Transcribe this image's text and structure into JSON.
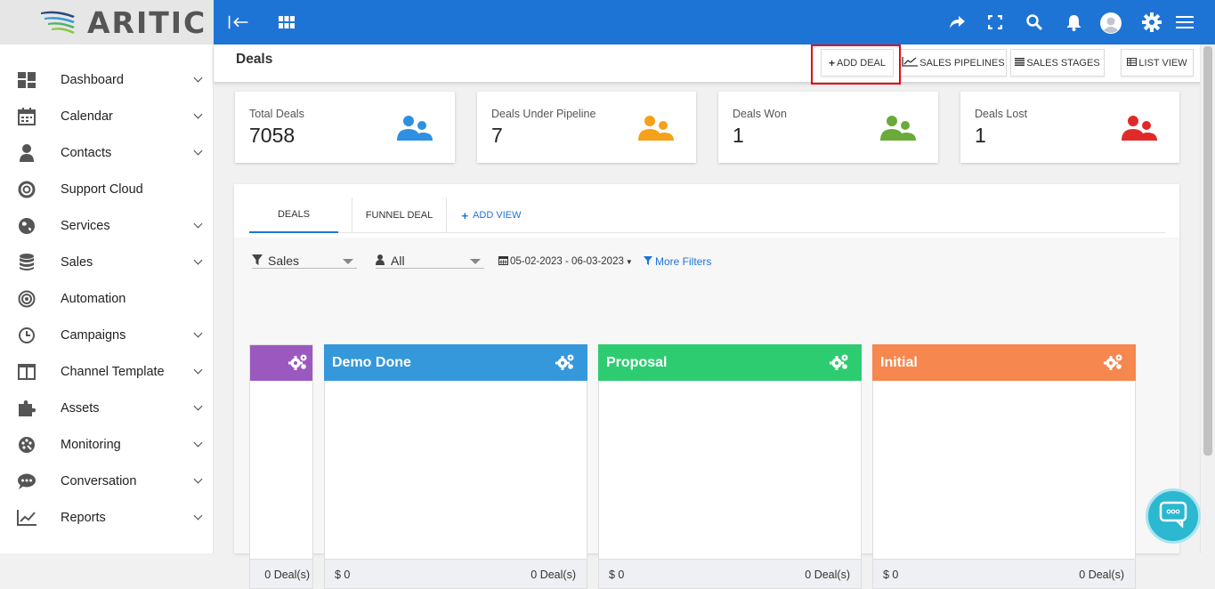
{
  "app": {
    "logo_text": "ARITIC"
  },
  "sidebar": {
    "items": [
      {
        "label": "Dashboard",
        "icon": "dashboard-icon",
        "expandable": true
      },
      {
        "label": "Calendar",
        "icon": "calendar-icon",
        "expandable": true
      },
      {
        "label": "Contacts",
        "icon": "user-icon",
        "expandable": true
      },
      {
        "label": "Support Cloud",
        "icon": "lifebuoy-icon",
        "expandable": false
      },
      {
        "label": "Services",
        "icon": "globe-icon",
        "expandable": true
      },
      {
        "label": "Sales",
        "icon": "database-icon",
        "expandable": true
      },
      {
        "label": "Automation",
        "icon": "target-icon",
        "expandable": false
      },
      {
        "label": "Campaigns",
        "icon": "clock-icon",
        "expandable": true
      },
      {
        "label": "Channel Template",
        "icon": "columns-icon",
        "expandable": true
      },
      {
        "label": "Assets",
        "icon": "puzzle-icon",
        "expandable": true
      },
      {
        "label": "Monitoring",
        "icon": "palette-icon",
        "expandable": true
      },
      {
        "label": "Conversation",
        "icon": "chat-icon",
        "expandable": true
      },
      {
        "label": "Reports",
        "icon": "line-chart-icon",
        "expandable": true
      }
    ]
  },
  "header": {
    "page_title": "Deals",
    "buttons": {
      "add_deal": "ADD DEAL",
      "sales_pipelines": "SALES PIPELINES",
      "sales_stages": "SALES STAGES",
      "list_view": "LIST VIEW"
    }
  },
  "stats": [
    {
      "label": "Total Deals",
      "value": "7058",
      "color": "#2f8fe0"
    },
    {
      "label": "Deals Under Pipeline",
      "value": "7",
      "color": "#f5a11a"
    },
    {
      "label": "Deals Won",
      "value": "1",
      "color": "#6aaa3a"
    },
    {
      "label": "Deals Lost",
      "value": "1",
      "color": "#e02a2a"
    }
  ],
  "tabs": {
    "deals": "DEALS",
    "funnel_deal": "FUNNEL DEAL",
    "add_view": "ADD VIEW"
  },
  "filters": {
    "pipeline": "Sales",
    "owner": "All",
    "date_range": "05-02-2023 - 06-03-2023",
    "more_filters": "More Filters"
  },
  "stages": [
    {
      "name": "",
      "color": "#9b59c0",
      "amount": "",
      "count": "0 Deal(s)"
    },
    {
      "name": "Demo Done",
      "color": "#3498db",
      "amount": "$ 0",
      "count": "0 Deal(s)"
    },
    {
      "name": "Proposal",
      "color": "#2ecc71",
      "amount": "$ 0",
      "count": "0 Deal(s)"
    },
    {
      "name": "Initial",
      "color": "#f5874f",
      "amount": "$ 0",
      "count": "0 Deal(s)"
    }
  ],
  "colors": {
    "topbar": "#1e74d5",
    "highlight": "#e30613",
    "chat": "#2bb8d0"
  }
}
